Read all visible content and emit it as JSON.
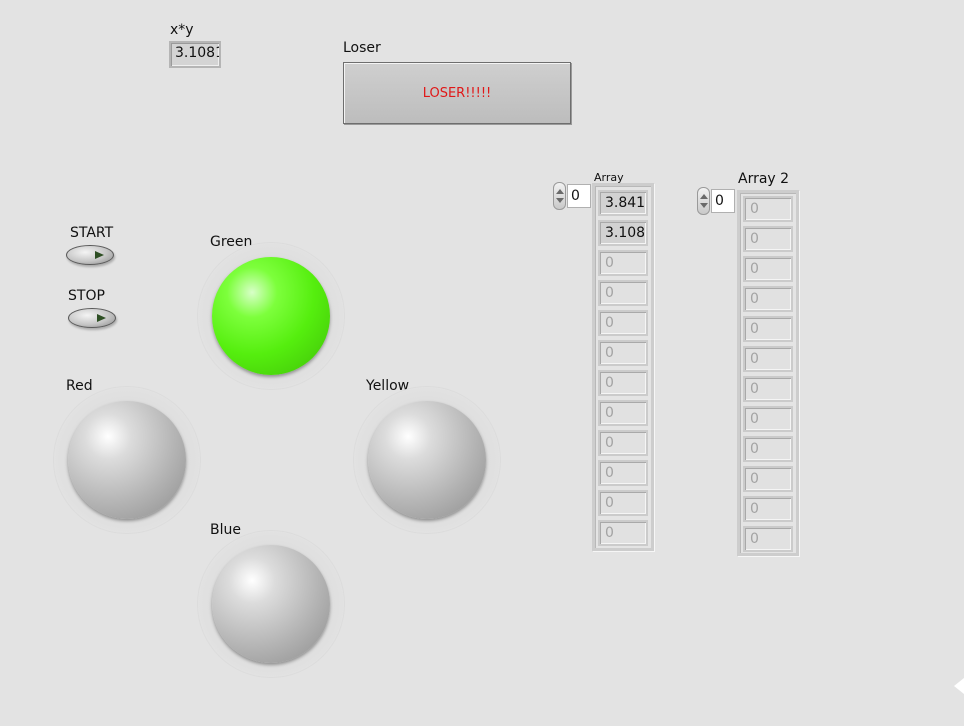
{
  "xy": {
    "label": "x*y",
    "value": "3.1081"
  },
  "loser": {
    "label": "Loser",
    "text": "LOSER!!!!!",
    "text_color": "#e01818"
  },
  "switches": [
    {
      "label": "START"
    },
    {
      "label": "STOP"
    }
  ],
  "leds": {
    "green": {
      "label": "Green",
      "state": "on",
      "color": "#55ee0e"
    },
    "red": {
      "label": "Red",
      "state": "off"
    },
    "yellow": {
      "label": "Yellow",
      "state": "off"
    },
    "blue": {
      "label": "Blue",
      "state": "off"
    }
  },
  "array1": {
    "label": "Array",
    "index": "0",
    "values": [
      "3.8415",
      "3.1081",
      "0",
      "0",
      "0",
      "0",
      "0",
      "0",
      "0",
      "0",
      "0",
      "0"
    ]
  },
  "array2": {
    "label": "Array 2",
    "index": "0",
    "values": [
      "0",
      "0",
      "0",
      "0",
      "0",
      "0",
      "0",
      "0",
      "0",
      "0",
      "0",
      "0"
    ]
  }
}
